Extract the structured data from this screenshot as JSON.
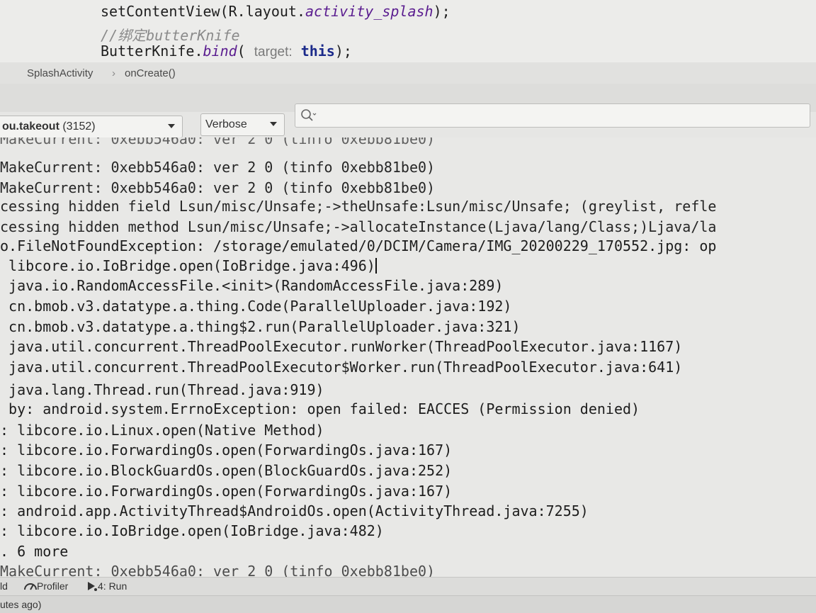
{
  "editor": {
    "line1": {
      "prefix": "setContentView(R.layout.",
      "italic": "activity_splash",
      "suffix": ");"
    },
    "line2": {
      "comment": "//绑定butterKnife"
    },
    "line3": {
      "prefix": "ButterKnife.",
      "italic": "bind",
      "open": "( ",
      "hint": "target:",
      "keyword": "this",
      "suffix": ");"
    }
  },
  "breadcrumb": {
    "class_name": "SplashActivity",
    "separator": "›",
    "method_name": "onCreate()"
  },
  "toolbar": {
    "process": {
      "bold": "ou.takeout",
      "pid": "(3152)"
    },
    "log_level": "Verbose",
    "search_icon": "search-icon",
    "search_value": ""
  },
  "log_lines": [
    "MakeCurrent: 0xebb546a0: ver 2 0 (tinfo 0xebb81be0)",
    "MakeCurrent: 0xebb546a0: ver 2 0 (tinfo 0xebb81be0)",
    "MakeCurrent: 0xebb546a0: ver 2 0 (tinfo 0xebb81be0)",
    "cessing hidden field Lsun/misc/Unsafe;->theUnsafe:Lsun/misc/Unsafe; (greylist, refle",
    "cessing hidden method Lsun/misc/Unsafe;->allocateInstance(Ljava/lang/Class;)Ljava/la",
    "o.FileNotFoundException: /storage/emulated/0/DCIM/Camera/IMG_20200229_170552.jpg: op",
    " libcore.io.IoBridge.open(IoBridge.java:496)",
    " java.io.RandomAccessFile.<init>(RandomAccessFile.java:289)",
    " cn.bmob.v3.datatype.a.thing.Code(ParallelUploader.java:192)",
    " cn.bmob.v3.datatype.a.thing$2.run(ParallelUploader.java:321)",
    " java.util.concurrent.ThreadPoolExecutor.runWorker(ThreadPoolExecutor.java:1167)",
    " java.util.concurrent.ThreadPoolExecutor$Worker.run(ThreadPoolExecutor.java:641)",
    " java.lang.Thread.run(Thread.java:919)",
    " by: android.system.ErrnoException: open failed: EACCES (Permission denied)",
    ": libcore.io.Linux.open(Native Method)",
    ": libcore.io.ForwardingOs.open(ForwardingOs.java:167)",
    ": libcore.io.BlockGuardOs.open(BlockGuardOs.java:252)",
    ": libcore.io.ForwardingOs.open(ForwardingOs.java:167)",
    ": android.app.ActivityThread$AndroidOs.open(ActivityThread.java:7255)",
    ": libcore.io.IoBridge.open(IoBridge.java:482)",
    ". 6 more",
    "MakeCurrent: 0xebb546a0: ver 2 0 (tinfo 0xebb81be0)"
  ],
  "toolwindows": {
    "left_fragment": "ld",
    "profiler": "Profiler",
    "run": "4: Run"
  },
  "status": {
    "text": "utes ago)"
  }
}
